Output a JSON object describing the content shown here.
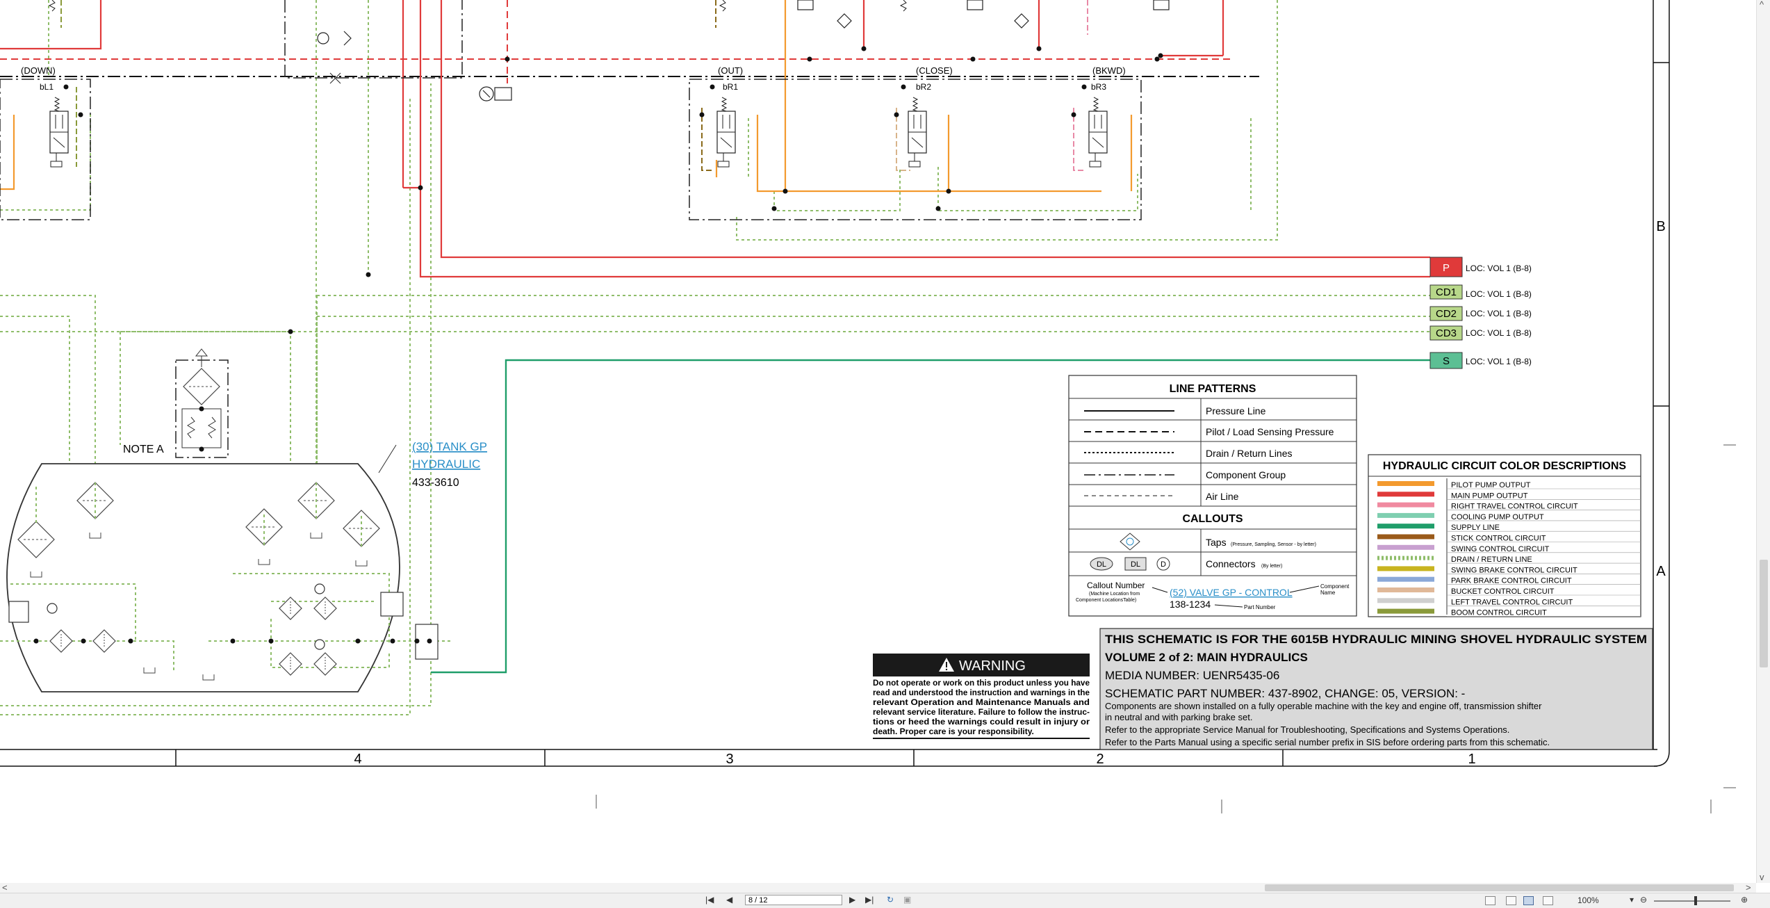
{
  "colors": {
    "main_pump": "#e03a3a",
    "pilot_pump": "#f39a2e",
    "drain": "#8fbd6a",
    "supply": "#1f9e6a",
    "pink": "#e889a6",
    "brown": "#8a6a1a",
    "tan": "#d8b48a",
    "frame": "#111111",
    "title_bg": "#d9d9d9",
    "warning_bg": "#1a1a1a"
  },
  "icons": {
    "warning": "warning-triangle-icon",
    "gauge": "gauge-icon",
    "tap": "tap-diamond-icon",
    "filter": "filter-diamond-icon"
  },
  "labels": {
    "down": "(DOWN)",
    "out": "(OUT)",
    "close": "(CLOSE)",
    "bkwd": "(BKWD)",
    "bl1": "bL1",
    "br1": "bR1",
    "br2": "bR2",
    "br3": "bR3",
    "note_a": "NOTE A"
  },
  "tank_callout": {
    "link_line1": "(30) TANK GP",
    "link_line2": "HYDRAULIC",
    "part_number": "433-3610"
  },
  "connectors": [
    {
      "code": "P",
      "loc": "LOC: VOL 1 (B-8)"
    },
    {
      "code": "CD1",
      "loc": "LOC: VOL 1 (B-8)"
    },
    {
      "code": "CD2",
      "loc": "LOC: VOL 1 (B-8)"
    },
    {
      "code": "CD3",
      "loc": "LOC: VOL 1 (B-8)"
    },
    {
      "code": "S",
      "loc": "LOC: VOL 1 (B-8)"
    }
  ],
  "line_patterns": {
    "title": "LINE PATTERNS",
    "items": [
      "Pressure Line",
      "Pilot / Load Sensing Pressure",
      "Drain / Return Lines",
      "Component Group",
      "Air Line"
    ]
  },
  "callouts": {
    "title": "CALLOUTS",
    "taps_label": "Taps",
    "taps_note": "(Pressure, Sampling, Sensor - by letter)",
    "connectors_label": "Connectors",
    "connectors_note": "(By letter)",
    "dl": "DL",
    "d": "D",
    "callout_number": "Callout Number",
    "callout_note1": "(Machine Location from",
    "callout_note2": "Component LocationsTable)",
    "example_link": "(52) VALVE GP - CONTROL",
    "component_name1": "Component",
    "component_name2": "Name",
    "example_part": "138-1234",
    "part_number": "Part Number"
  },
  "color_descriptions": {
    "title": "HYDRAULIC CIRCUIT COLOR DESCRIPTIONS",
    "items": [
      {
        "label": "PILOT PUMP OUTPUT",
        "color": "#f39a2e"
      },
      {
        "label": "MAIN PUMP OUTPUT",
        "color": "#e03a3a"
      },
      {
        "label": "RIGHT TRAVEL CONTROL CIRCUIT",
        "color": "#f08aa0"
      },
      {
        "label": "COOLING PUMP OUTPUT",
        "color": "#7fcfb0"
      },
      {
        "label": "SUPPLY LINE",
        "color": "#1f9e6a"
      },
      {
        "label": "STICK CONTROL CIRCUIT",
        "color": "#9a5a1a"
      },
      {
        "label": "SWING CONTROL CIRCUIT",
        "color": "#c8a0d0"
      },
      {
        "label": "DRAIN / RETURN LINE",
        "color": "#8fbd6a"
      },
      {
        "label": "SWING BRAKE CONTROL CIRCUIT",
        "color": "#c8b420"
      },
      {
        "label": "PARK BRAKE CONTROL CIRCUIT",
        "color": "#8aa8d8"
      },
      {
        "label": "BUCKET CONTROL CIRCUIT",
        "color": "#e0b898"
      },
      {
        "label": "LEFT TRAVEL CONTROL CIRCUIT",
        "color": "#cfcfcf"
      },
      {
        "label": "BOOM CONTROL CIRCUIT",
        "color": "#8a9a3a"
      }
    ]
  },
  "warning": {
    "title": "WARNING",
    "lines": [
      "Do not operate or work on this product unless you have",
      "read and understood the instruction and warnings in the",
      "relevant Operation and Maintenance Manuals and",
      "relevant service literature. Failure to follow the instruc-",
      "tions or heed the warnings could result in injury or",
      "death. Proper care is your responsibility."
    ]
  },
  "title_block": {
    "line1": "THIS SCHEMATIC IS FOR THE 6015B HYDRAULIC MINING SHOVEL HYDRAULIC SYSTEM",
    "line2": "VOLUME 2 of 2: MAIN HYDRAULICS",
    "media": "MEDIA NUMBER: UENR5435-06",
    "part": "SCHEMATIC PART NUMBER: 437-8902, CHANGE: 05, VERSION: -",
    "note1": "Components are shown installed on a fully operable machine with the key and engine off, transmission shifter",
    "note2": "in neutral and with parking brake set.",
    "note3": "Refer to the appropriate Service Manual for Troubleshooting, Specifications and Systems Operations.",
    "note4": "Refer to the Parts Manual using a specific serial number prefix in SIS before ordering parts from this schematic."
  },
  "zones": {
    "columns": [
      "4",
      "3",
      "2",
      "1"
    ],
    "rows": [
      "B",
      "A"
    ]
  },
  "viewer": {
    "page_field": "8 / 12",
    "zoom": "100%"
  }
}
